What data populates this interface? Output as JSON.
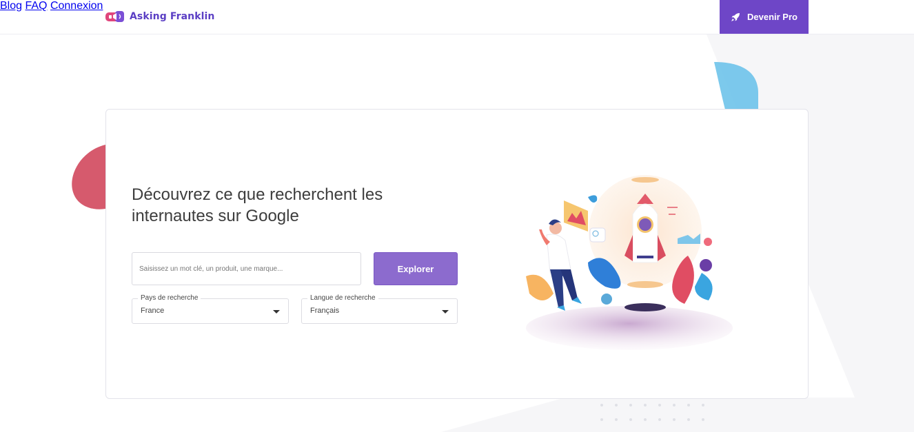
{
  "header": {
    "logo_text": "Asking Franklin",
    "nav": [
      {
        "label": "Blog"
      },
      {
        "label": "FAQ"
      },
      {
        "label": "Connexion"
      }
    ],
    "pro_button": {
      "label": "Devenir Pro",
      "icon": "rocket-icon"
    }
  },
  "hero": {
    "headline_line1": "Découvrez ce que recherchent les",
    "headline_line2": "internautes sur Google",
    "search": {
      "placeholder": "Saisissez un mot clé, un produit, une marque...",
      "value": ""
    },
    "explore_button": "Explorer",
    "country_select": {
      "label": "Pays de recherche",
      "selected": "France"
    },
    "language_select": {
      "label": "Langue de recherche",
      "selected": "Français"
    }
  },
  "colors": {
    "brand": "#6e46c7",
    "button": "#8c6bce",
    "accent_red": "#d95a6c",
    "accent_blue": "#5eb5e0"
  }
}
